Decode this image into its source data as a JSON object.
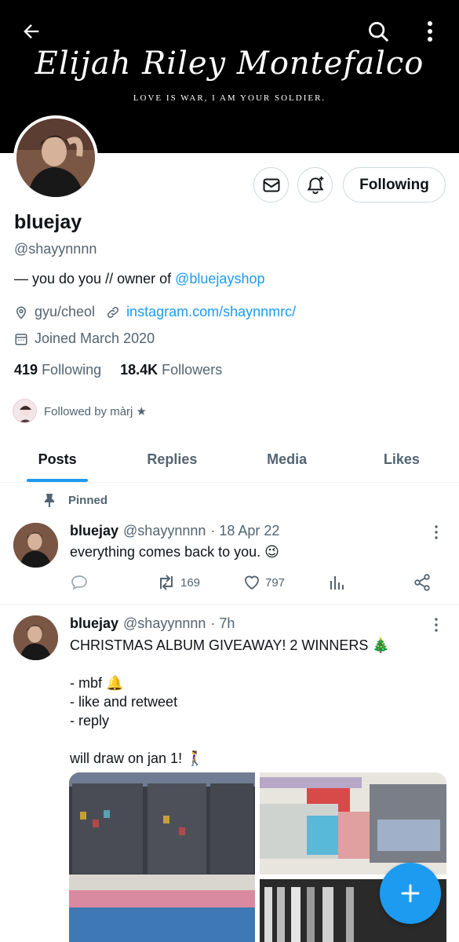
{
  "banner": {
    "signature": "Elijah Riley Montefalco",
    "tagline": "LOVE IS WAR, I AM YOUR SOLDIER."
  },
  "profile": {
    "display_name": "bluejay",
    "handle": "@shayynnnn",
    "bio_prefix": "— you do you // owner of ",
    "bio_mention": "@bluejayshop",
    "location": "gyu/cheol",
    "website": "instagram.com/shaynnmrc/",
    "joined": "Joined March 2020",
    "following_count": "419",
    "following_label": "Following",
    "followers_count": "18.4K",
    "followers_label": "Followers",
    "followed_by": "Followed by màrj ★",
    "follow_button": "Following"
  },
  "tabs": [
    "Posts",
    "Replies",
    "Media",
    "Likes"
  ],
  "pinned_label": "Pinned",
  "tweets": [
    {
      "name": "bluejay",
      "handle": "@shayynnnn",
      "time": "· 18 Apr 22",
      "text": "everything comes back to you. 😉",
      "retweets": "169",
      "likes": "797"
    },
    {
      "name": "bluejay",
      "handle": "@shayynnnn",
      "time": "· 7h",
      "text": "CHRISTMAS ALBUM GIVEAWAY! 2 WINNERS 🎄\n\n- mbf 🔔\n- like and retweet\n- reply\n\nwill draw on jan 1! 🚶‍♀️"
    }
  ],
  "colors": {
    "accent": "#1d9bf0",
    "secondary_text": "#536471",
    "banner": "#000000"
  }
}
